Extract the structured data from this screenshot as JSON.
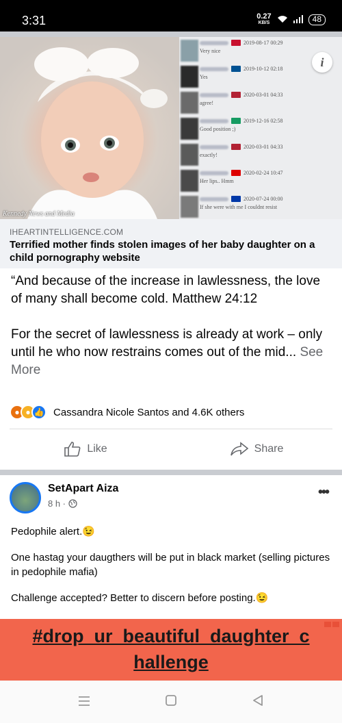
{
  "status": {
    "time": "3:31",
    "speed": "0.27",
    "speed_unit": "KB/S",
    "battery": "48"
  },
  "link_card": {
    "photo_credit": "Kennedy News and Media",
    "comments": [
      {
        "date": "2019-08-17 00:29",
        "text": "Very nice",
        "flag_color": "#c8102e"
      },
      {
        "date": "2019-10-12 02:18",
        "text": "Yes",
        "flag_color": "#005293"
      },
      {
        "date": "2020-03-01 04:33",
        "text": "agree!",
        "flag_color": "#b22234"
      },
      {
        "date": "2019-12-16 02:58",
        "text": "Good position ;)",
        "flag_color": "#169b62"
      },
      {
        "date": "2020-03-01 04:33",
        "text": "exactly!",
        "flag_color": "#b22234"
      },
      {
        "date": "2020-02-24 10:47",
        "text": "Her lips.. Hmm",
        "flag_color": "#dd0000"
      },
      {
        "date": "2020-07-24 00:00",
        "text": "If she were with me I couldnt resist",
        "flag_color": "#0038a8"
      }
    ],
    "domain": "IHEARTINTELLIGENCE.COM",
    "title": "Terrified mother finds stolen images of her baby daughter on a child pornography website"
  },
  "post1": {
    "text_p1": "“And because of the increase in lawlessness, the love of many shall become cold. Matthew 24:12",
    "text_p2": "For the secret of lawlessness is already at work – only until he who now restrains comes out of the mid...",
    "see_more": "See More",
    "reaction_names": "Cassandra Nicole Santos and 4.6K others",
    "like_label": "Like",
    "share_label": "Share"
  },
  "post2": {
    "author": "SetApart Aiza",
    "time": "8 h ·",
    "p1": "Pedophile alert.😉",
    "p2": "One hastag your daugthers will be put in black market (selling pictures in pedophile mafia)",
    "p3": "Challenge accepted? Better to discern before posting.😉",
    "banner_line1": "#drop_ur_beautiful_daughter_c",
    "banner_line2": "hallenge"
  }
}
